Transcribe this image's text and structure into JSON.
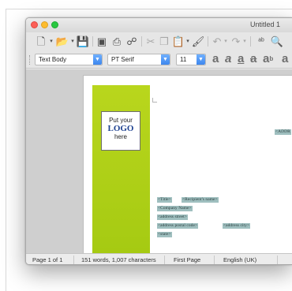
{
  "window": {
    "title": "Untitled 1"
  },
  "formatting_bar": {
    "paragraph_style": "Text Body",
    "font_name": "PT Serif",
    "font_size": "11"
  },
  "logo_placeholder": {
    "line1": "Put your",
    "line2": "LOGO",
    "line3": "here"
  },
  "fields": {
    "address_right": "<ADDR",
    "title": "<Title>",
    "recipient_name": "<Recipient's name>",
    "company_name": "<Company Name>",
    "address_street": "<address street>",
    "address_postal_code": "<address postal code>",
    "address_city": "<address city>",
    "state": "<state>"
  },
  "status_bar": {
    "page": "Page 1 of 1",
    "word_count": "151 words, 1,007 characters",
    "page_style": "First Page",
    "language": "English (UK)"
  }
}
